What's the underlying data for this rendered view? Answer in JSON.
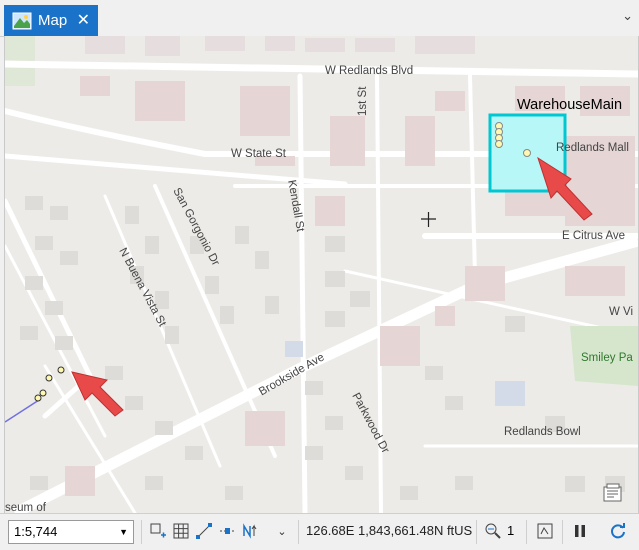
{
  "tab": {
    "label": "Map",
    "close": "✕",
    "chevron": "⌄"
  },
  "map": {
    "labels": {
      "redlands_blvd": "W Redlands Blvd",
      "state_st": "W State St",
      "first_st": "1st St",
      "kendall": "Kendall St",
      "san_gorgonio": "San Gorgonio Dr",
      "buena_vista": "N Buena Vista St",
      "brookside": "Brookside Ave",
      "parkwood": "Parkwood Dr",
      "citrus": "E Citrus Ave",
      "redlands_mall": "Redlands Mall",
      "smiley_park": "Smiley Pa",
      "w_vi": "W Vi",
      "redlands_bowl": "Redlands Bowl",
      "museum": "seum of",
      "warehouse": "WarehouseMain"
    },
    "colors": {
      "highlight_fill": "#b7f7f7",
      "highlight_border": "#00c8d2",
      "arrow": "#e84a4a",
      "point_fill": "#fff8b0"
    }
  },
  "statusbar": {
    "scale": "1:5,744",
    "coordinates": "126.68E 1,843,661.48N ftUS",
    "selected_count": "1"
  }
}
